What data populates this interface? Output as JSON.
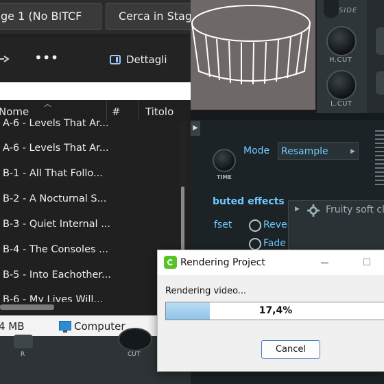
{
  "explorer": {
    "address_tab": "ge 1 (No BITCF",
    "search_placeholder": "Cerca in Stag",
    "toolbar": {
      "more": "•••",
      "details_label": "Dettagli"
    },
    "columns": {
      "name": "Nome",
      "number": "#",
      "title": "Titolo"
    },
    "rows": [
      "A-6 - Levels That Ar...",
      "A-6 - Levels That Ar...",
      "B-1 - All That Follo...",
      "B-2 - A Nocturnal S...",
      "B-3 - Quiet Internal ...",
      "B-4 - The Consoles ...",
      "B-5 - Into Eachother...",
      "B-6 - My Lives Will..."
    ],
    "status": {
      "size": "4 MB",
      "location": "Computer"
    }
  },
  "plugin": {
    "side_label": "SIDE",
    "hcut_label": "H.CUT",
    "lcut_label": "L.CUT",
    "mode_label": "Mode",
    "mode_value": "Resample",
    "time_label": "TIME",
    "effects_label": "buted effects",
    "offset_label": "fset",
    "reverse_label": "Rever",
    "fade_label": "Fade",
    "fruity_label": "Fruity soft cli",
    "r_label": "R",
    "cut_label": "CUT"
  },
  "dialog": {
    "title": "Rendering Project",
    "status_text": "Rendering video...",
    "progress_label": "17,4%",
    "progress_fraction": 0.2,
    "cancel_label": "Cancel",
    "accent": "#58c328"
  }
}
